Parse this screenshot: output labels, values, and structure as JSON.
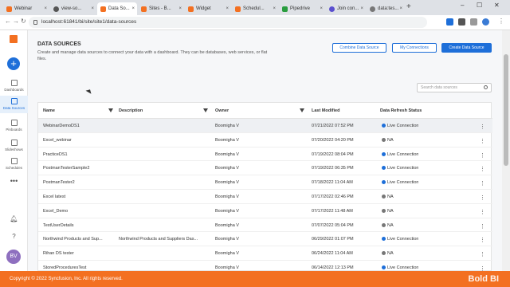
{
  "browser": {
    "tabs": [
      {
        "label": "Webinar"
      },
      {
        "label": "view-so..."
      },
      {
        "label": "Data So..."
      },
      {
        "label": "Sites - B..."
      },
      {
        "label": "Widget"
      },
      {
        "label": "Schedul..."
      },
      {
        "label": "Pipedrive"
      },
      {
        "label": "Join con..."
      },
      {
        "label": "data:tes..."
      }
    ],
    "url": "localhost:61841/bi/site/site1/data-sources"
  },
  "sidebar": {
    "items": [
      {
        "label": "Dashboards"
      },
      {
        "label": "Data Sources"
      },
      {
        "label": "Pinboards"
      },
      {
        "label": "Slideshows"
      },
      {
        "label": "Schedules"
      }
    ],
    "avatar": "BV"
  },
  "header": {
    "title": "DATA SOURCES",
    "description": "Create and manage data sources to connect your data with a dashboard. They can be databases, web services, or flat files.",
    "combine_btn": "Combine Data Source",
    "connections_btn": "My Connections",
    "create_btn": "Create Data Source",
    "search_placeholder": "Search data sources"
  },
  "grid": {
    "columns": [
      "Name",
      "Description",
      "Owner",
      "Last Modified",
      "Data Refresh Status"
    ],
    "rows": [
      {
        "name": "WebinarDemoDS1",
        "desc": "",
        "owner": "Boomigha V",
        "modified": "07/21/2022 07:52 PM",
        "status": "Live Connection",
        "live": true
      },
      {
        "name": "Excel_webinar",
        "desc": "",
        "owner": "Boomigha V",
        "modified": "07/20/2022 04:20 PM",
        "status": "NA",
        "live": false
      },
      {
        "name": "PracticeDS1",
        "desc": "",
        "owner": "Boomigha V",
        "modified": "07/19/2022 08:04 PM",
        "status": "Live Connection",
        "live": true
      },
      {
        "name": "PostmanTesterSample2",
        "desc": "",
        "owner": "Boomigha V",
        "modified": "07/19/2022 06:35 PM",
        "status": "Live Connection",
        "live": true
      },
      {
        "name": "PostmanTester2",
        "desc": "",
        "owner": "Boomigha V",
        "modified": "07/18/2022 11:04 AM",
        "status": "Live Connection",
        "live": true
      },
      {
        "name": "Excel latest",
        "desc": "",
        "owner": "Boomigha V",
        "modified": "07/17/2022 02:46 PM",
        "status": "NA",
        "live": false
      },
      {
        "name": "Excel_Demo",
        "desc": "",
        "owner": "Boomigha V",
        "modified": "07/17/2022 11:48 AM",
        "status": "NA",
        "live": false
      },
      {
        "name": "TestUserDetails",
        "desc": "",
        "owner": "Boomigha V",
        "modified": "07/07/2022 05:04 PM",
        "status": "NA",
        "live": false
      },
      {
        "name": "Northwind Products and Sup...",
        "desc": "Northwind Products and Suppliers Das...",
        "owner": "Boomigha V",
        "modified": "06/29/2022 01:07 PM",
        "status": "Live Connection",
        "live": true
      },
      {
        "name": "Rihan DS tester",
        "desc": "",
        "owner": "Boomigha V",
        "modified": "06/24/2022 11:04 AM",
        "status": "NA",
        "live": false
      },
      {
        "name": "StoredProceduresTest",
        "desc": "",
        "owner": "Boomigha V",
        "modified": "06/14/2022 12:13 PM",
        "status": "Live Connection",
        "live": true
      }
    ]
  },
  "footer": {
    "copyright": "Copyright © 2022 Syncfusion, Inc.   All rights reserved.",
    "brand": "Bold BI"
  },
  "colors": {
    "accent": "#1e6fd9",
    "brand": "#f37021",
    "live": "#1e6fd9",
    "na": "#777777"
  }
}
